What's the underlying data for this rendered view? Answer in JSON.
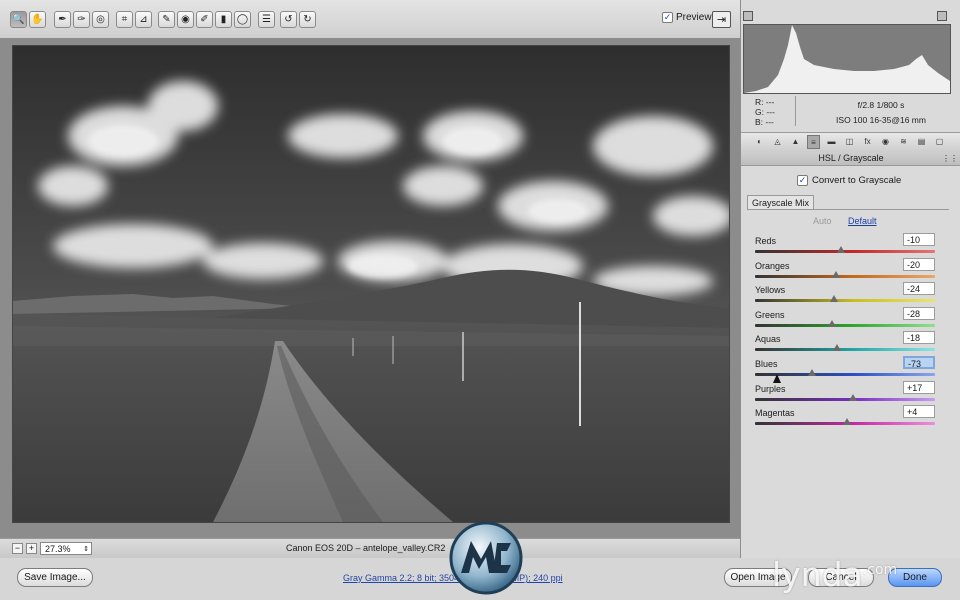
{
  "toolbar": {
    "tools": [
      {
        "name": "zoom-tool",
        "glyph": "🔍"
      },
      {
        "name": "hand-tool",
        "glyph": "✋"
      },
      {
        "name": "white-balance-tool",
        "glyph": "✒"
      },
      {
        "name": "color-sampler-tool",
        "glyph": "✑"
      },
      {
        "name": "targeted-adjustment-tool",
        "glyph": "◎"
      },
      {
        "name": "crop-tool",
        "glyph": "⌗"
      },
      {
        "name": "straighten-tool",
        "glyph": "⊿"
      },
      {
        "name": "spot-removal-tool",
        "glyph": "✎"
      },
      {
        "name": "red-eye-tool",
        "glyph": "◉"
      },
      {
        "name": "adjustment-brush-tool",
        "glyph": "✐"
      },
      {
        "name": "graduated-filter-tool",
        "glyph": "▮"
      },
      {
        "name": "radial-filter-tool",
        "glyph": "◯"
      },
      {
        "name": "preferences-tool",
        "glyph": "☰"
      },
      {
        "name": "rotate-left-tool",
        "glyph": "↺"
      },
      {
        "name": "rotate-right-tool",
        "glyph": "↻"
      }
    ],
    "preview_label": "Preview",
    "preview_checked": true
  },
  "status": {
    "zoom": "27.3%",
    "camera": "Canon EOS 20D  –  antelope_valley.CR2"
  },
  "bottom": {
    "save_label": "Save Image...",
    "workflow_link": "Gray Gamma 2.2; 8 bit; 3504 by 2336 (8.2MP); 240 ppi",
    "open_label": "Open Image",
    "cancel_label": "Cancel",
    "done_label": "Done"
  },
  "readout": {
    "r": "R:  ---",
    "g": "G:  ---",
    "b": "B:  ---",
    "aperture_shutter": "f/2.8    1/800 s",
    "iso_lens": "ISO 100    16-35@16 mm"
  },
  "panel": {
    "title": "HSL / Grayscale",
    "convert_label": "Convert to Grayscale",
    "convert_checked": true,
    "subtab": "Grayscale Mix",
    "auto_label": "Auto",
    "default_label": "Default"
  },
  "sliders": [
    {
      "label": "Reds",
      "value": "-10",
      "num": -10,
      "colors": [
        "#333",
        "#c02a2a",
        "#e37575"
      ]
    },
    {
      "label": "Oranges",
      "value": "-20",
      "num": -20,
      "colors": [
        "#333",
        "#c46a1d",
        "#eaa768"
      ]
    },
    {
      "label": "Yellows",
      "value": "-24",
      "num": -24,
      "colors": [
        "#333",
        "#c8be21",
        "#ebe46f"
      ]
    },
    {
      "label": "Greens",
      "value": "-28",
      "num": -28,
      "colors": [
        "#333",
        "#2fa62f",
        "#8fe08f"
      ]
    },
    {
      "label": "Aquas",
      "value": "-18",
      "num": -18,
      "colors": [
        "#333",
        "#23a6a6",
        "#8ee2e2"
      ]
    },
    {
      "label": "Blues",
      "value": "-73",
      "num": -73,
      "colors": [
        "#333",
        "#2a4fc4",
        "#8aa6ef"
      ],
      "focus": true
    },
    {
      "label": "Purples",
      "value": "+17",
      "num": 17,
      "colors": [
        "#333",
        "#7a2fc0",
        "#c79bef"
      ]
    },
    {
      "label": "Magentas",
      "value": "+4",
      "num": 4,
      "colors": [
        "#333",
        "#c22aa3",
        "#ec8edb"
      ]
    }
  ],
  "watermark": {
    "brand": "lynda",
    "tld": ".com"
  }
}
